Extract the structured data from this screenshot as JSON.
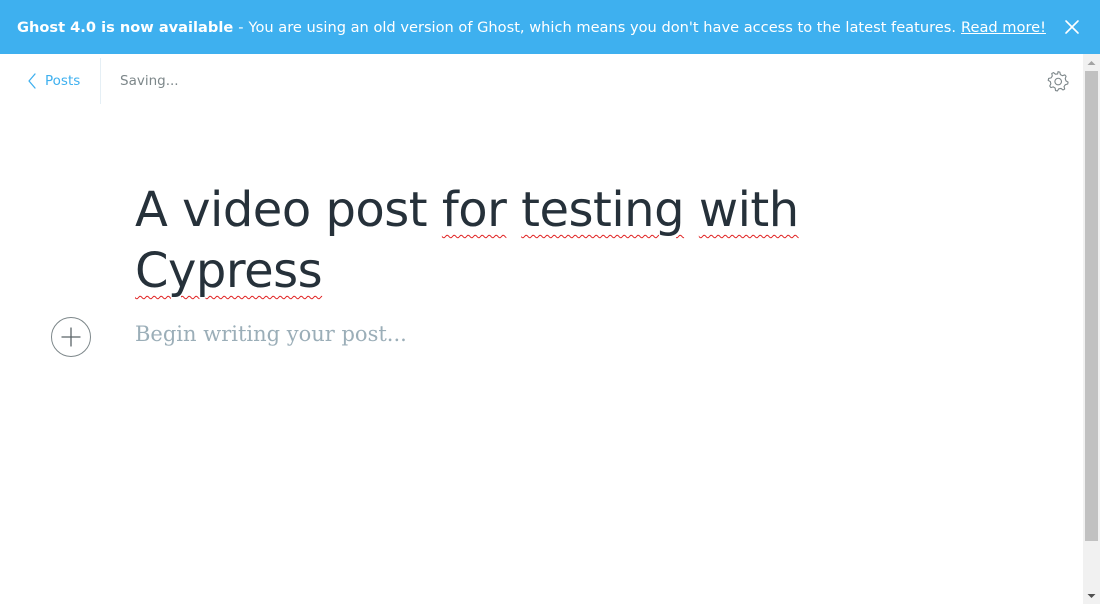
{
  "banner": {
    "bold_text": "Ghost 4.0 is now available",
    "separator": "-",
    "message": "You are using an old version of Ghost, which means you don't have access to the latest features.",
    "link_text": "Read more!",
    "close_icon": "close-icon",
    "background_color": "#3eb0ef"
  },
  "header": {
    "back_label": "Posts",
    "back_icon": "chevron-left-icon",
    "status": "Saving...",
    "settings_icon": "gear-icon"
  },
  "editor": {
    "title_words": [
      "A video post",
      "for",
      "testing",
      "with",
      "Cypress"
    ],
    "body_placeholder": "Begin writing your post...",
    "add_card_icon": "plus-icon"
  },
  "colors": {
    "accent": "#3eb0ef",
    "title_text": "#26313a",
    "placeholder_text": "#9baeb8",
    "spellcheck_underline": "#e02020"
  }
}
